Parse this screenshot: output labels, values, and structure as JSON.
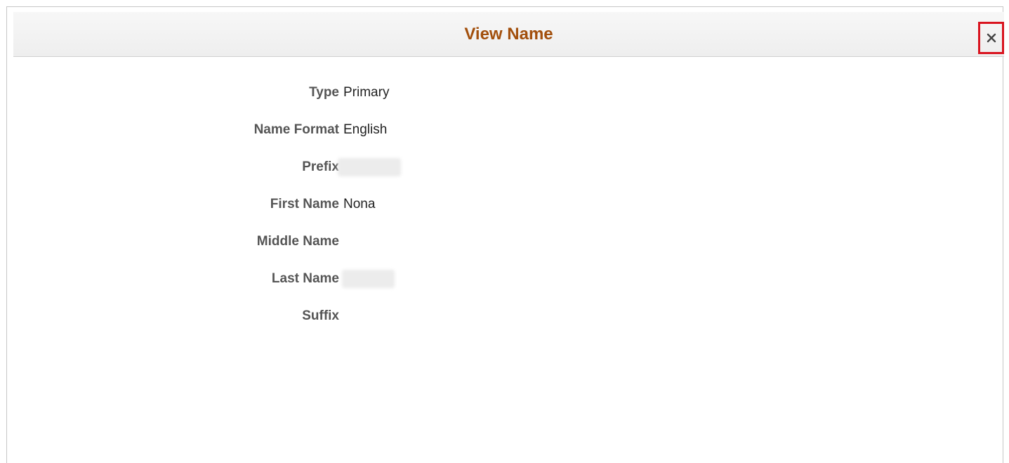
{
  "dialog": {
    "title": "View Name",
    "close_label": "×"
  },
  "fields": [
    {
      "label": "Type",
      "value": "Primary"
    },
    {
      "label": "Name Format",
      "value": "English"
    },
    {
      "label": "Prefix",
      "value": ""
    },
    {
      "label": "First Name",
      "value": "Nona"
    },
    {
      "label": "Middle Name",
      "value": ""
    },
    {
      "label": "Last Name",
      "value": ""
    },
    {
      "label": "Suffix",
      "value": ""
    }
  ],
  "colors": {
    "title": "#a24f0c",
    "label": "#555555",
    "close_highlight": "#d9141f"
  }
}
